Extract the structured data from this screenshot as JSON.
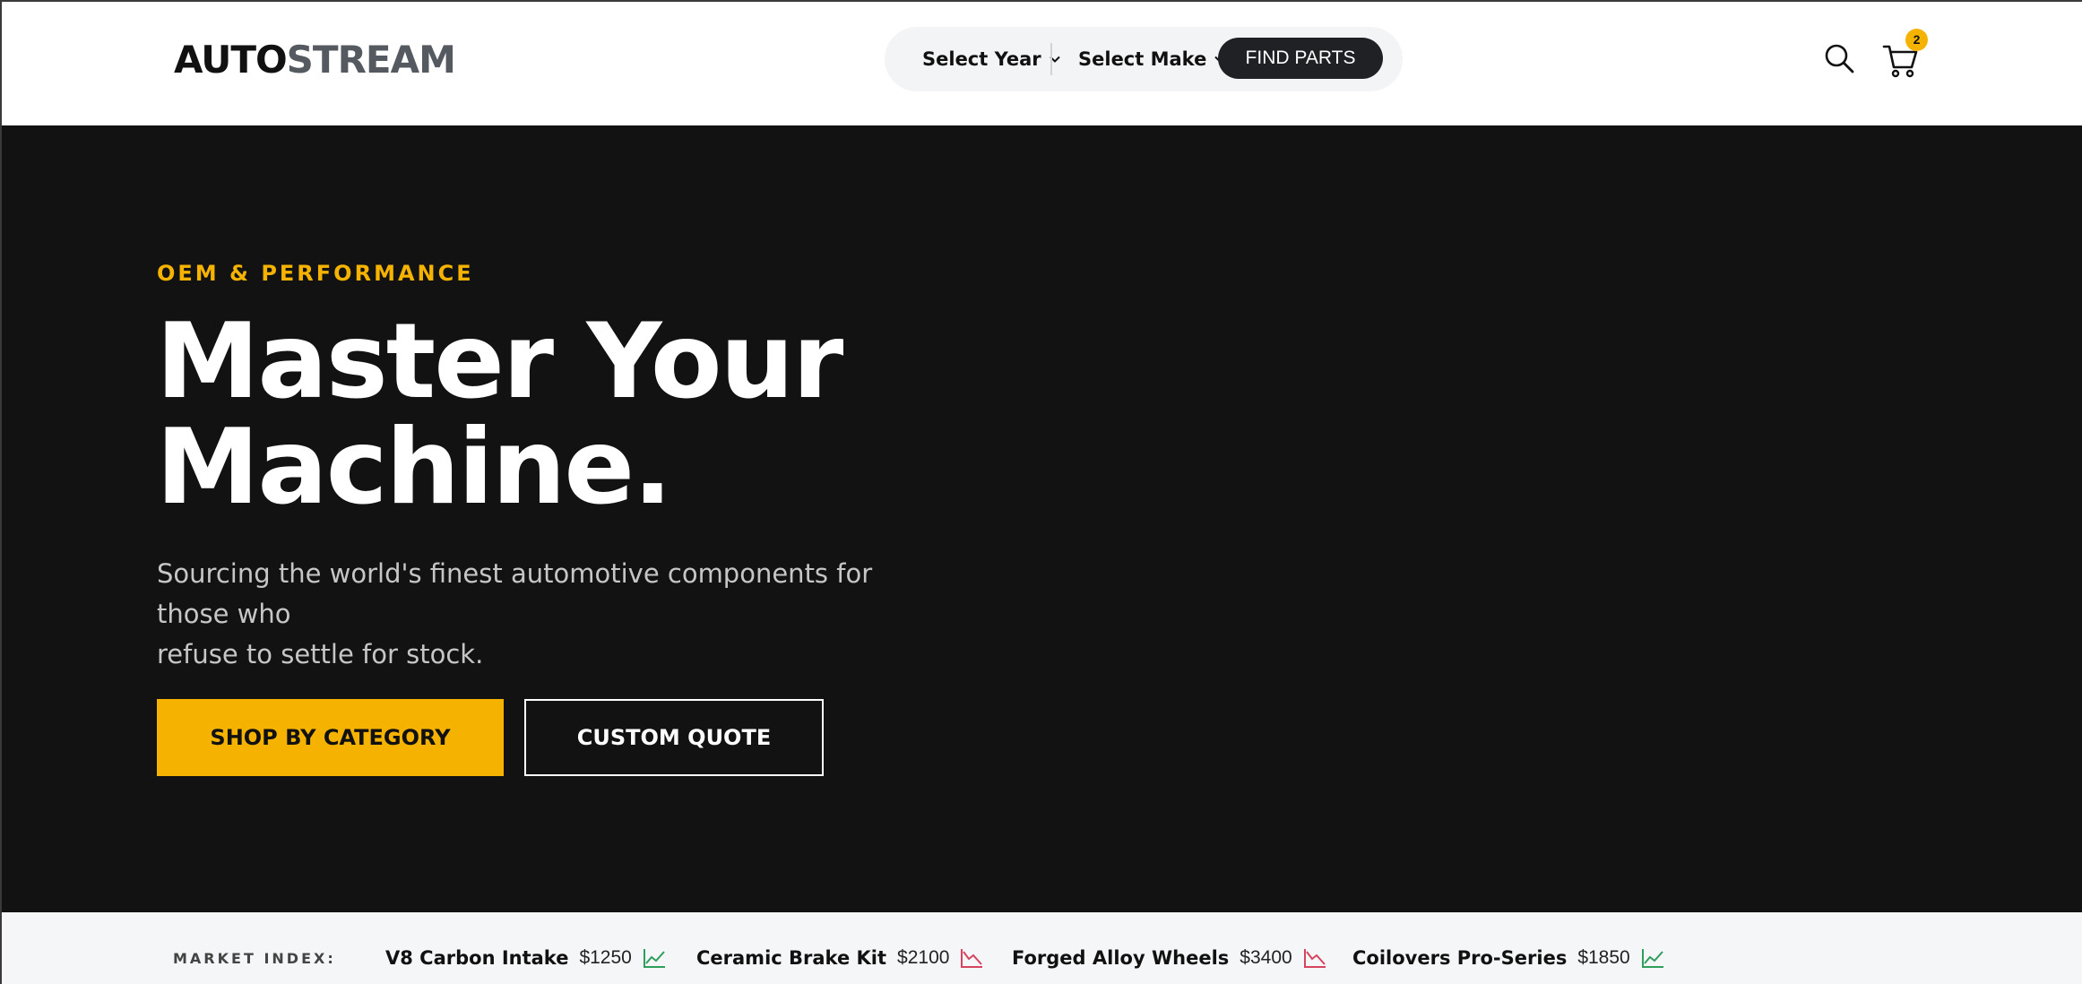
{
  "header": {
    "logo_part1": "AUTO",
    "logo_part2": "STREAM",
    "finder": {
      "year_label": "Select Year",
      "make_label": "Select Make",
      "find_button": "FIND PARTS"
    },
    "cart_count": "2"
  },
  "hero": {
    "eyebrow": "OEM & PERFORMANCE",
    "headline_line1": "Master Your",
    "headline_line2": "Machine.",
    "subline_line1": "Sourcing the world's finest automotive components for those who",
    "subline_line2": "refuse to settle for stock.",
    "primary_cta": "SHOP BY CATEGORY",
    "secondary_cta": "CUSTOM QUOTE"
  },
  "market": {
    "label": "MARKET INDEX:",
    "items": [
      {
        "name": "V8 Carbon Intake",
        "price": "$1250",
        "trend": "up"
      },
      {
        "name": "Ceramic Brake Kit",
        "price": "$2100",
        "trend": "down"
      },
      {
        "name": "Forged Alloy Wheels",
        "price": "$3400",
        "trend": "down"
      },
      {
        "name": "Coilovers Pro-Series",
        "price": "$1850",
        "trend": "up"
      }
    ]
  },
  "colors": {
    "accent": "#f5b300",
    "hero_bg": "#121212",
    "trend_up": "#2e9e5b",
    "trend_down": "#d64560"
  }
}
